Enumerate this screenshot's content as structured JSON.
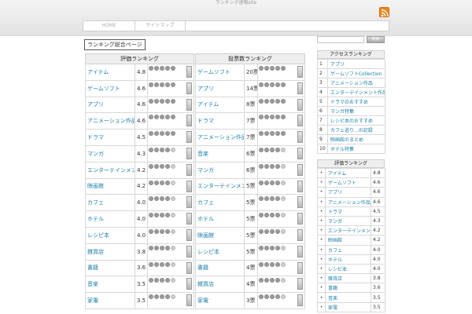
{
  "header": {
    "site_title": "ランキング速報site",
    "nav": [
      {
        "label": "HOME"
      },
      {
        "label": "サイトマップ"
      }
    ]
  },
  "main": {
    "page_title": "ランキング総合ページ",
    "left_table": {
      "header": "評価ランキング",
      "rows": [
        {
          "name": "アイテム",
          "score": "4.8",
          "rating": 4.8
        },
        {
          "name": "ゲームソフト",
          "score": "4.6",
          "rating": 4.6
        },
        {
          "name": "アプリ",
          "score": "4.6",
          "rating": 4.6
        },
        {
          "name": "アニメーション作品",
          "score": "4.6",
          "rating": 4.6
        },
        {
          "name": "ドラマ",
          "score": "4.5",
          "rating": 4.5
        },
        {
          "name": "マンガ",
          "score": "4.3",
          "rating": 4.3
        },
        {
          "name": "エンターテインメント作品",
          "score": "4.2",
          "rating": 4.2
        },
        {
          "name": "映画館",
          "score": "4.2",
          "rating": 4.2
        },
        {
          "name": "カフェ",
          "score": "4.0",
          "rating": 4.0
        },
        {
          "name": "ホテル",
          "score": "4.0",
          "rating": 4.0
        },
        {
          "name": "レシピ本",
          "score": "4.0",
          "rating": 4.0
        },
        {
          "name": "雑貨店",
          "score": "3.8",
          "rating": 3.8
        },
        {
          "name": "書籍",
          "score": "3.6",
          "rating": 3.6
        },
        {
          "name": "音楽",
          "score": "3.5",
          "rating": 3.5
        },
        {
          "name": "家電",
          "score": "3.5",
          "rating": 3.5
        }
      ]
    },
    "right_table": {
      "header": "投票数ランキング",
      "rows": [
        {
          "name": "ゲームソフト",
          "score": "20票",
          "rating": 4.6
        },
        {
          "name": "アプリ",
          "score": "14票",
          "rating": 4.6
        },
        {
          "name": "アイテム",
          "score": "8票",
          "rating": 4.8
        },
        {
          "name": "ドラマ",
          "score": "7票",
          "rating": 4.5
        },
        {
          "name": "アニメーション作品",
          "score": "7票",
          "rating": 4.6
        },
        {
          "name": "音楽",
          "score": "6票",
          "rating": 3.5
        },
        {
          "name": "マンガ",
          "score": "6票",
          "rating": 4.3
        },
        {
          "name": "エンターテインメント作品",
          "score": "5票",
          "rating": 4.2
        },
        {
          "name": "カフェ",
          "score": "5票",
          "rating": 4.0
        },
        {
          "name": "ホテル",
          "score": "5票",
          "rating": 4.0
        },
        {
          "name": "映画館",
          "score": "5票",
          "rating": 4.2
        },
        {
          "name": "レシピ本",
          "score": "5票",
          "rating": 4.0
        },
        {
          "name": "書籍",
          "score": "4票",
          "rating": 3.6
        },
        {
          "name": "雑貨店",
          "score": "4票",
          "rating": 3.8
        },
        {
          "name": "家電",
          "score": "3票",
          "rating": 3.5
        }
      ]
    }
  },
  "sidebar": {
    "search": {
      "button_label": "検索",
      "placeholder": ""
    },
    "ranking_widget": {
      "title": "アクセスランキング",
      "items": [
        {
          "num": "1",
          "label": "アプリ"
        },
        {
          "num": "2",
          "label": "ゲームソフトCollection"
        },
        {
          "num": "3",
          "label": "アニメーション作品"
        },
        {
          "num": "4",
          "label": "エンターテインメント作品"
        },
        {
          "num": "5",
          "label": "ドラマのおすすめ"
        },
        {
          "num": "6",
          "label": "マンガ特集"
        },
        {
          "num": "7",
          "label": "レシピ本のおすすめ"
        },
        {
          "num": "8",
          "label": "カフェ巡り...の記録"
        },
        {
          "num": "9",
          "label": "映画館のまとめ"
        },
        {
          "num": "10",
          "label": "ホテル特集"
        }
      ]
    },
    "score_widget": {
      "title": "評価ランキング",
      "items": [
        {
          "label": "アイテム",
          "score": "4.8"
        },
        {
          "label": "ゲームソフト",
          "score": "4.6"
        },
        {
          "label": "アプリ",
          "score": "4.6"
        },
        {
          "label": "アニメーション作品",
          "score": "4.6"
        },
        {
          "label": "ドラマ",
          "score": "4.5"
        },
        {
          "label": "マンガ",
          "score": "4.3"
        },
        {
          "label": "エンターテインメント作品",
          "score": "4.2"
        },
        {
          "label": "映画館",
          "score": "4.2"
        },
        {
          "label": "カフェ",
          "score": "4.0"
        },
        {
          "label": "ホテル",
          "score": "4.0"
        },
        {
          "label": "レシピ本",
          "score": "4.0"
        },
        {
          "label": "雑貨店",
          "score": "3.8"
        },
        {
          "label": "書籍",
          "score": "3.6"
        },
        {
          "label": "音楽",
          "score": "3.5"
        },
        {
          "label": "家電",
          "score": "3.5"
        }
      ]
    }
  },
  "colors": {
    "link": "#1a7fa8",
    "rss": "#f0861f",
    "header_bg": "#e8e8e8"
  },
  "icons": {
    "rss": "rss-icon",
    "search": "search-icon",
    "star": "star-icon",
    "vote": "vote-button"
  }
}
